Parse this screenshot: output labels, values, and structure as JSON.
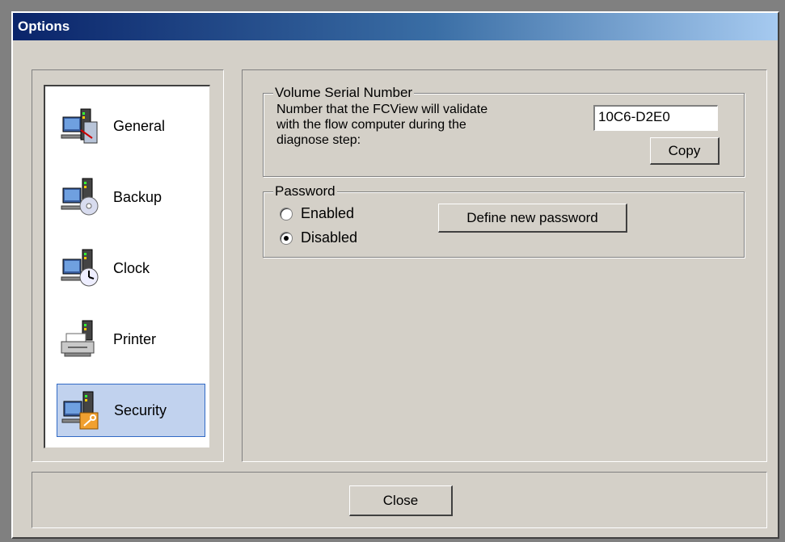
{
  "window": {
    "title": "Options"
  },
  "nav": {
    "items": [
      {
        "label": "General",
        "icon": "general-computer-icon",
        "selected": false
      },
      {
        "label": "Backup",
        "icon": "backup-disc-icon",
        "selected": false
      },
      {
        "label": "Clock",
        "icon": "clock-icon",
        "selected": false
      },
      {
        "label": "Printer",
        "icon": "printer-icon",
        "selected": false
      },
      {
        "label": "Security",
        "icon": "security-key-icon",
        "selected": true
      }
    ]
  },
  "volume_serial": {
    "legend": "Volume Serial Number",
    "description_line1": "Number that the FCView will validate",
    "description_line2": "with the flow computer during the",
    "description_line3": "diagnose step:",
    "value": "10C6-D2E0",
    "copy_label": "Copy"
  },
  "password": {
    "legend": "Password",
    "enabled_label": "Enabled",
    "disabled_label": "Disabled",
    "selected": "Disabled",
    "define_label": "Define new password"
  },
  "footer": {
    "close_label": "Close"
  },
  "colors": {
    "face": "#d4d0c8",
    "title_start": "#0a246a",
    "title_end": "#a6caf0",
    "selection": "#c1d2ee"
  }
}
